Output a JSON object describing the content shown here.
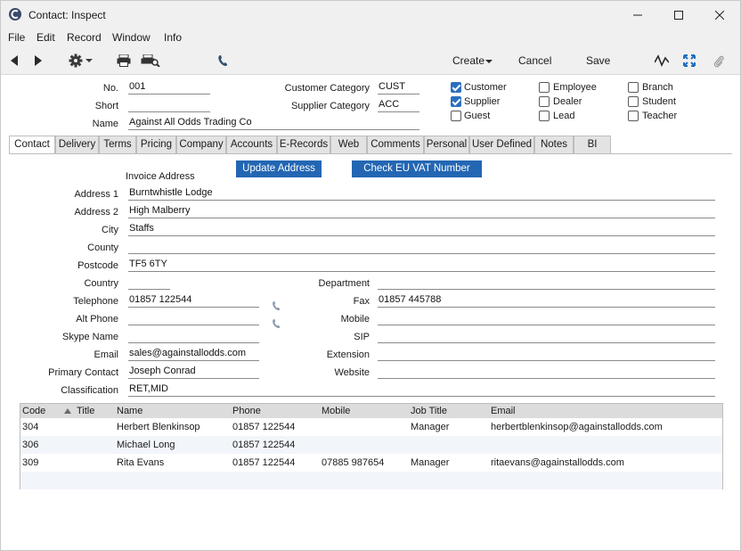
{
  "window": {
    "title": "Contact: Inspect"
  },
  "menu": [
    "File",
    "Edit",
    "Record",
    "Window",
    "Info"
  ],
  "toolbar": {
    "create": "Create",
    "cancel": "Cancel",
    "save": "Save"
  },
  "header": {
    "no_label": "No.",
    "no_value": "001",
    "short_label": "Short",
    "short_value": "",
    "name_label": "Name",
    "name_value": "Against All Odds Trading Co",
    "cust_cat_label": "Customer Category",
    "cust_cat_value": "CUST",
    "supp_cat_label": "Supplier Category",
    "supp_cat_value": "ACC"
  },
  "checkboxes": [
    {
      "label": "Customer",
      "checked": true
    },
    {
      "label": "Supplier",
      "checked": true
    },
    {
      "label": "Guest",
      "checked": false
    },
    {
      "label": "Employee",
      "checked": false
    },
    {
      "label": "Dealer",
      "checked": false
    },
    {
      "label": "Lead",
      "checked": false
    },
    {
      "label": "Branch",
      "checked": false
    },
    {
      "label": "Student",
      "checked": false
    },
    {
      "label": "Teacher",
      "checked": false
    }
  ],
  "tabs": [
    "Contact",
    "Delivery",
    "Terms",
    "Pricing",
    "Company",
    "Accounts",
    "E-Records",
    "Web",
    "Comments",
    "Personal",
    "User Defined",
    "Notes",
    "BI"
  ],
  "contact": {
    "invoice_address": "Invoice Address",
    "update_address": "Update Address",
    "check_vat": "Check EU VAT Number",
    "address1_label": "Address 1",
    "address1": "Burntwhistle Lodge",
    "address2_label": "Address 2",
    "address2": "High Malberry",
    "city_label": "City",
    "city": "Staffs",
    "county_label": "County",
    "county": "",
    "postcode_label": "Postcode",
    "postcode": "TF5 6TY",
    "country_label": "Country",
    "country": "",
    "department_label": "Department",
    "department": "",
    "telephone_label": "Telephone",
    "telephone": "01857 122544",
    "fax_label": "Fax",
    "fax": "01857 445788",
    "altphone_label": "Alt Phone",
    "altphone": "",
    "mobile_label": "Mobile",
    "mobile": "",
    "skype_label": "Skype Name",
    "skype": "",
    "sip_label": "SIP",
    "sip": "",
    "email_label": "Email",
    "email": "sales@againstallodds.com",
    "extension_label": "Extension",
    "extension": "",
    "primary_label": "Primary Contact",
    "primary": "Joseph Conrad",
    "website_label": "Website",
    "website": "",
    "class_label": "Classification",
    "classification": "RET,MID"
  },
  "grid": {
    "columns": [
      "Code",
      "Title",
      "Name",
      "Phone",
      "Mobile",
      "Job Title",
      "Email"
    ],
    "rows": [
      [
        "304",
        "",
        "Herbert Blenkinsop",
        "01857 122544",
        "",
        "Manager",
        "herbertblenkinsop@againstallodds.com"
      ],
      [
        "306",
        "",
        "Michael Long",
        "01857 122544",
        "",
        "",
        ""
      ],
      [
        "309",
        "",
        "Rita Evans",
        "01857 122544",
        "07885 987654",
        "Manager",
        "ritaevans@againstallodds.com"
      ]
    ]
  },
  "colors": {
    "accent": "#2366b3",
    "check": "#2b6fc0",
    "chrome": "#f0f0f0",
    "grid_header": "#dcdcdc",
    "row_alt": "#f2f6fb"
  }
}
